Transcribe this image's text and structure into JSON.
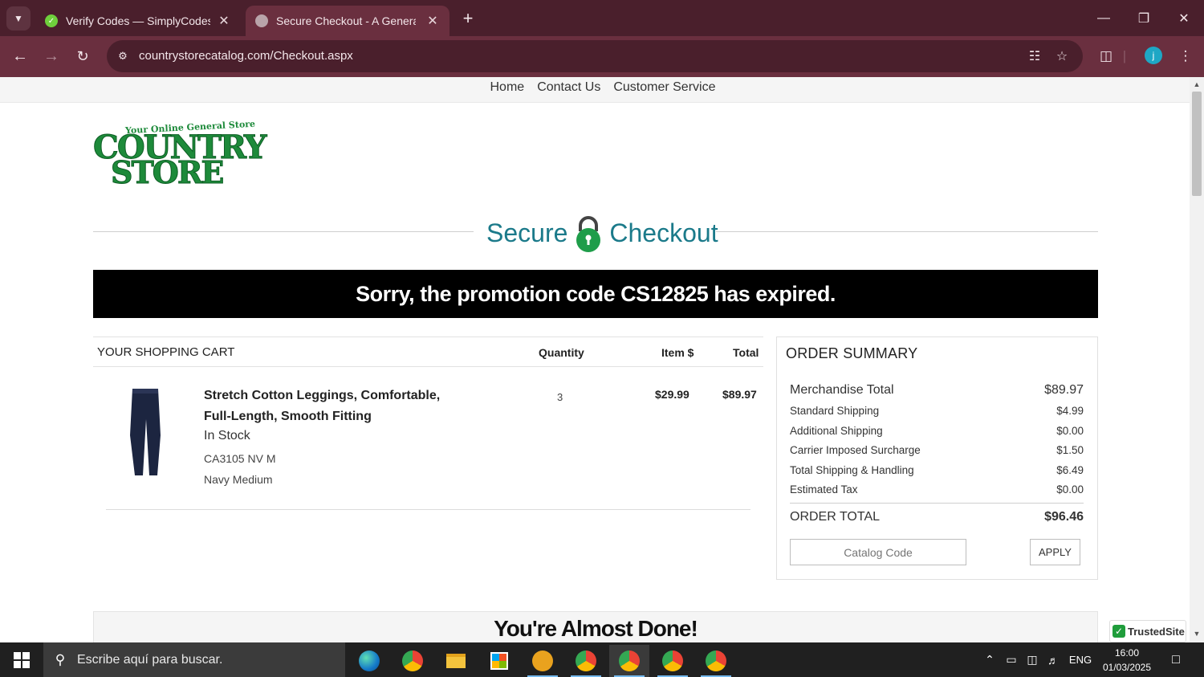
{
  "browser": {
    "tabs": [
      {
        "title": "Verify Codes — SimplyCodes",
        "active": false
      },
      {
        "title": "Secure Checkout - A General Store",
        "active": true
      }
    ],
    "url": "countrystorecatalog.com/Checkout.aspx",
    "profile_initial": "j"
  },
  "site": {
    "nav": [
      "Home",
      "Contact Us",
      "Customer Service"
    ],
    "logo": {
      "tagline": "Your Online General Store",
      "line1": "COUNTRY",
      "line2": "STORE"
    },
    "secure_left": "Secure",
    "secure_right": "Checkout",
    "promo_message": "Sorry, the promotion code CS12825 has expired.",
    "cart": {
      "header": {
        "title": "YOUR SHOPPING CART",
        "quantity": "Quantity",
        "item_price": "Item $",
        "total": "Total"
      },
      "items": [
        {
          "name": "Stretch Cotton Leggings, Comfortable, Full-Length, Smooth Fitting",
          "stock": "In Stock",
          "sku": "CA3105 NV M",
          "variant": "Navy Medium",
          "quantity": "3",
          "item_price": "$29.99",
          "total": "$89.97"
        }
      ]
    },
    "summary": {
      "title": "ORDER SUMMARY",
      "rows": [
        {
          "label": "Merchandise Total",
          "value": "$89.97"
        },
        {
          "label": "Standard Shipping",
          "value": "$4.99"
        },
        {
          "label": "Additional Shipping",
          "value": "$0.00"
        },
        {
          "label": "Carrier Imposed Surcharge",
          "value": "$1.50"
        },
        {
          "label": "Total Shipping & Handling",
          "value": "$6.49"
        },
        {
          "label": "Estimated Tax",
          "value": "$0.00"
        }
      ],
      "total_label": "ORDER TOTAL",
      "total_value": "$96.46",
      "catalog_placeholder": "Catalog Code",
      "apply_label": "APPLY"
    },
    "almost_done": "You're Almost Done!",
    "trusted_badge": "TrustedSite"
  },
  "taskbar": {
    "search_placeholder": "Escribe aquí para buscar.",
    "language": "ENG",
    "time": "16:00",
    "date": "01/03/2025"
  },
  "colors": {
    "tabstrip": "#4a1f2c",
    "toolbar": "#6a2f3f",
    "brand_green": "#1d8a3a",
    "secure_teal": "#1b7a8a",
    "banner_bg": "#000000"
  }
}
